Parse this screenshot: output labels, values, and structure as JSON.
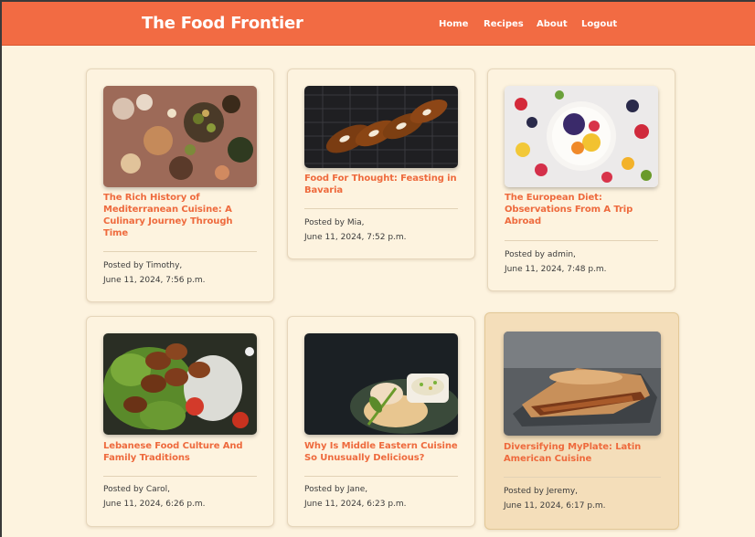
{
  "brand": {
    "name": "The Food Frontier"
  },
  "nav": {
    "home": "Home",
    "recipes": "Recipes",
    "about": "About",
    "logout": "Logout"
  },
  "posts": [
    {
      "title": "The Rich History of Mediterranean Cuisine: A Culinary Journey Through Time",
      "author": "Posted by Timothy,",
      "date": "June 11, 2024, 7:56 p.m."
    },
    {
      "title": "Food For Thought: Feasting in Bavaria",
      "author": "Posted by Mia,",
      "date": "June 11, 2024, 7:52 p.m."
    },
    {
      "title": "The European Diet: Observations From A Trip Abroad",
      "author": "Posted by admin,",
      "date": "June 11, 2024, 7:48 p.m."
    },
    {
      "title": "Lebanese Food Culture And Family Traditions",
      "author": "Posted by Carol,",
      "date": "June 11, 2024, 6:26 p.m."
    },
    {
      "title": "Why Is Middle Eastern Cuisine So Unusually Delicious?",
      "author": "Posted by Jane,",
      "date": "June 11, 2024, 6:23 p.m."
    },
    {
      "title": "Diversifying MyPlate: Latin American Cuisine",
      "author": "Posted by Jeremy,",
      "date": "June 11, 2024, 6:17 p.m."
    }
  ],
  "colors": {
    "navbar": "#f26b43",
    "page_background": "#fdf3df",
    "title_accent": "#ee6a3d",
    "hover_card": "#f4deba"
  }
}
